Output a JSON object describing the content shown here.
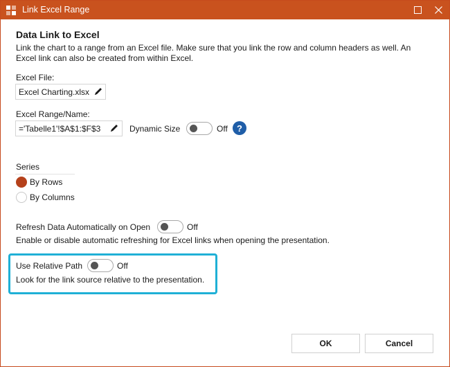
{
  "window": {
    "title": "Link Excel Range",
    "accent_color": "#c9521e",
    "app_icon": "app-logo-icon",
    "controls": [
      "maximize-icon",
      "close-icon"
    ]
  },
  "header": {
    "title": "Data Link to Excel",
    "description": "Link the chart to a range from an Excel file. Make sure that you link the row and column headers as well. An Excel link can also be created from within Excel."
  },
  "excel_file": {
    "label": "Excel File:",
    "value": "Excel Charting.xlsx",
    "edit_icon": "pencil-icon"
  },
  "excel_range": {
    "label": "Excel Range/Name:",
    "value": "='Tabelle1'!$A$1:$F$3",
    "edit_icon": "pencil-icon"
  },
  "dynamic_size": {
    "label": "Dynamic Size",
    "state": "Off",
    "help": "?"
  },
  "series": {
    "label": "Series",
    "options": [
      {
        "label": "By Rows",
        "checked": true
      },
      {
        "label": "By Columns",
        "checked": false
      }
    ],
    "selected_color": "#b5411b"
  },
  "refresh": {
    "label": "Refresh Data Automatically on Open",
    "state": "Off",
    "description": "Enable or disable automatic refreshing for Excel links when opening the presentation."
  },
  "relative_path": {
    "label": "Use Relative Path",
    "state": "Off",
    "description": "Look for the link source relative to the presentation.",
    "highlight_color": "#1fb0d6"
  },
  "buttons": {
    "ok": "OK",
    "cancel": "Cancel"
  }
}
